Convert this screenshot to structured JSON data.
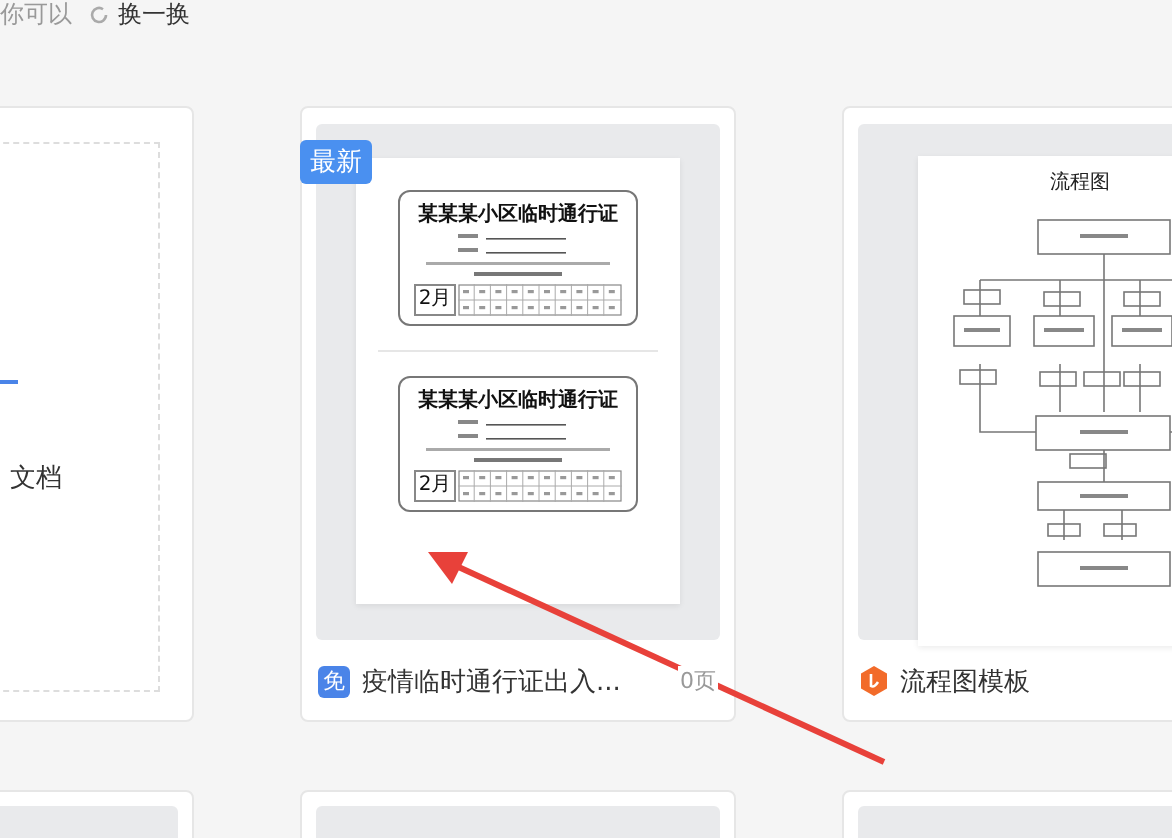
{
  "top_bar": {
    "hint": "你可以",
    "refresh_label": "换一换"
  },
  "cards": [
    {
      "kind": "blank",
      "label": "文档"
    },
    {
      "kind": "pass",
      "badge": "最新",
      "passes": [
        {
          "pass_title": "某某某小区临时通行证",
          "month": "2月"
        },
        {
          "pass_title": "某某某小区临时通行证",
          "month": "2月"
        }
      ],
      "free_badge": "免",
      "title": "疫情临时通行证出入...",
      "pages": "0页"
    },
    {
      "kind": "flowchart",
      "chart_title": "流程图",
      "title": "流程图模板"
    }
  ]
}
